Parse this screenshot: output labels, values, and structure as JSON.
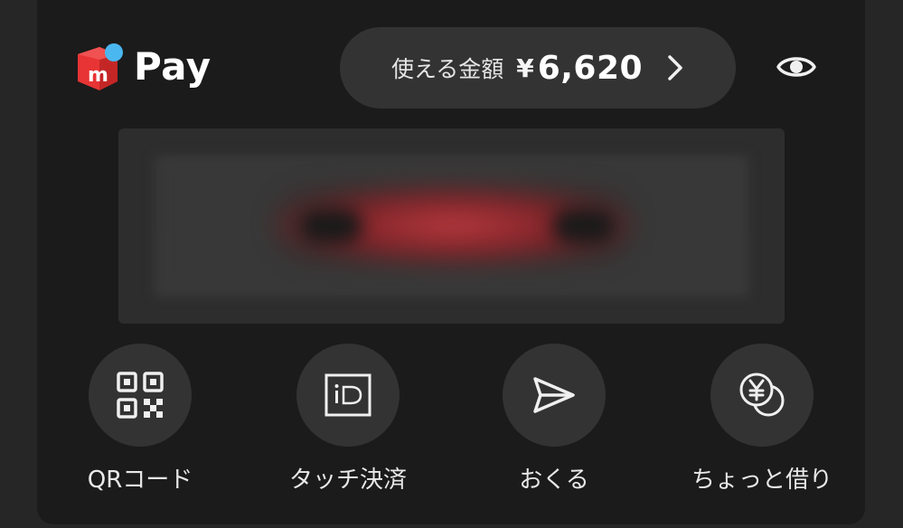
{
  "logo": {
    "brand_mark": "m",
    "text": "Pay"
  },
  "balance": {
    "label": "使える金額",
    "currency": "¥",
    "amount": "6,620"
  },
  "icons": {
    "logo": "mercari-box-icon",
    "chevron": "chevron-right-icon",
    "eye": "eye-icon",
    "qr": "qr-code-icon",
    "id": "id-touch-icon",
    "send": "send-icon",
    "borrow": "yen-coins-icon"
  },
  "actions": [
    {
      "label": "QRコード"
    },
    {
      "label": "タッチ決済"
    },
    {
      "label": "おくる"
    },
    {
      "label": "ちょっと借り"
    }
  ],
  "colors": {
    "brand_red": "#e83434",
    "brand_blue": "#4ab7f0",
    "card_bg": "#1b1b1b",
    "button_bg": "#333333"
  }
}
